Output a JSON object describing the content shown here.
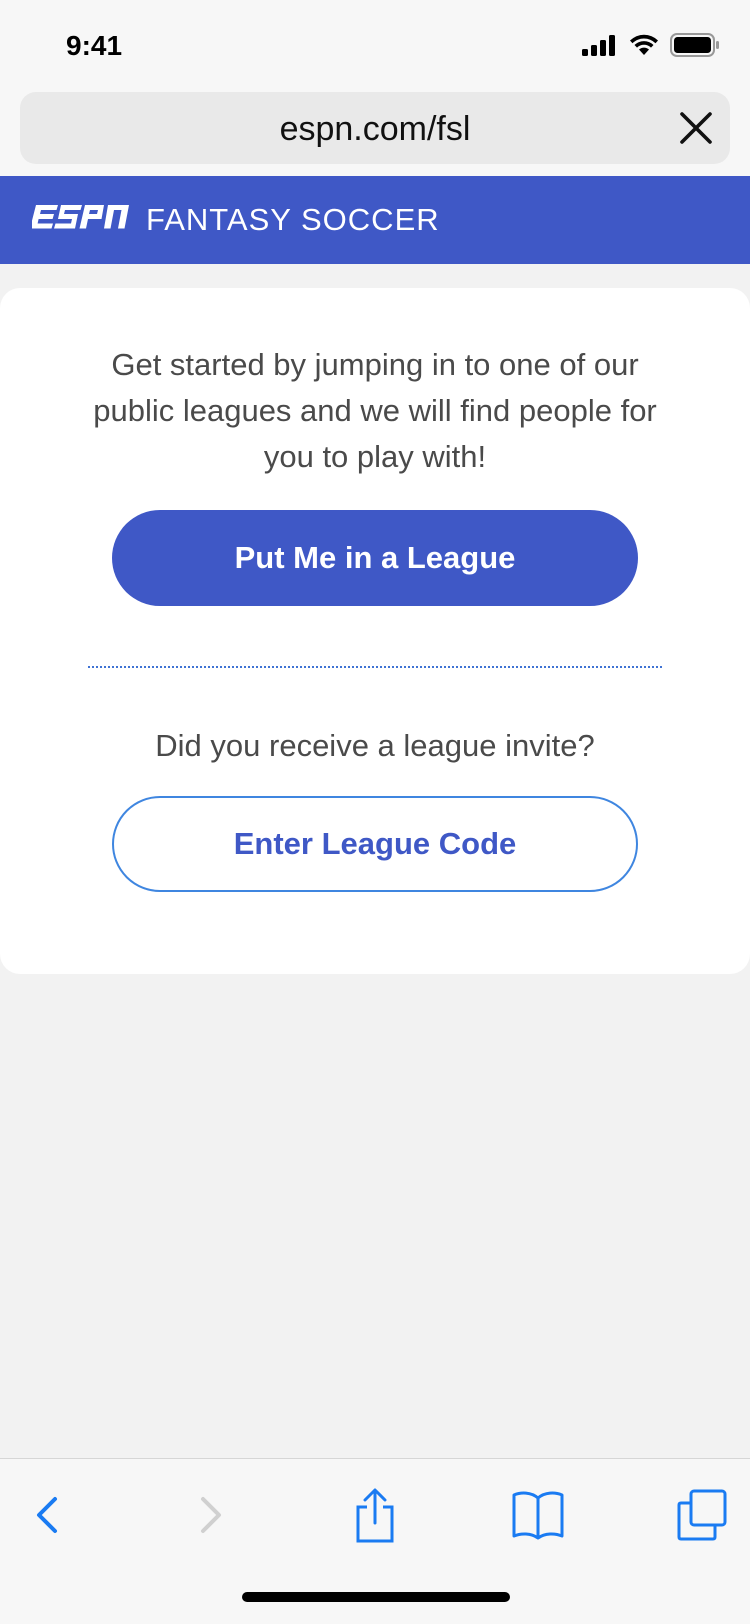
{
  "status_bar": {
    "time": "9:41",
    "icons": [
      "signal-icon",
      "wifi-icon",
      "battery-icon"
    ]
  },
  "browser": {
    "url": "espn.com/fsl",
    "close_icon": "close-icon"
  },
  "header": {
    "logo_text": "ESPN",
    "title": "FANTASY SOCCER",
    "background": "#3f58c6"
  },
  "card": {
    "intro": "Get started by jumping in to one of our public leagues and we will find people for you to play with!",
    "primary_button": "Put Me in a League",
    "invite_question": "Did you receive a league invite?",
    "secondary_button": "Enter League Code"
  },
  "toolbar": {
    "icons": [
      "back-icon",
      "forward-icon",
      "share-icon",
      "bookmarks-icon",
      "tabs-icon"
    ],
    "accent": "#1a7bf2"
  }
}
